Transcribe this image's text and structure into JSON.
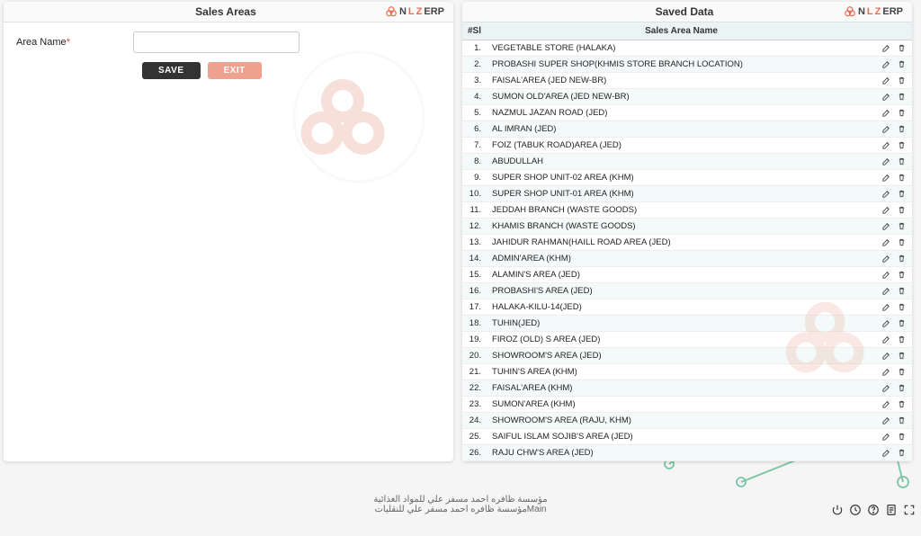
{
  "brand": {
    "n": "N",
    "l": "L",
    "z": "Z",
    "erp": "ERP"
  },
  "panels": {
    "left": {
      "title": "Sales Areas"
    },
    "right": {
      "title": "Saved Data"
    }
  },
  "form": {
    "area_label": "Area Name",
    "area_value": "",
    "save_label": "SAVE",
    "exit_label": "EXIT"
  },
  "table": {
    "head_num": "#Sl",
    "head_name": "Sales Area Name",
    "rows": [
      {
        "n": "1.",
        "name": "VEGETABLE STORE (HALAKA)"
      },
      {
        "n": "2.",
        "name": "PROBASHI SUPER SHOP(KHMIS STORE BRANCH LOCATION)"
      },
      {
        "n": "3.",
        "name": "FAISAL'AREA (JED NEW-BR)"
      },
      {
        "n": "4.",
        "name": "SUMON OLD'AREA (JED NEW-BR)"
      },
      {
        "n": "5.",
        "name": "NAZMUL JAZAN ROAD (JED)"
      },
      {
        "n": "6.",
        "name": "AL IMRAN (JED)"
      },
      {
        "n": "7.",
        "name": "FOIZ (TABUK ROAD)AREA (JED)"
      },
      {
        "n": "8.",
        "name": "ABUDULLAH"
      },
      {
        "n": "9.",
        "name": "SUPER SHOP UNIT-02 AREA (KHM)"
      },
      {
        "n": "10.",
        "name": "SUPER SHOP UNIT-01 AREA (KHM)"
      },
      {
        "n": "11.",
        "name": "JEDDAH BRANCH (WASTE GOODS)"
      },
      {
        "n": "12.",
        "name": "KHAMIS BRANCH (WASTE GOODS)"
      },
      {
        "n": "13.",
        "name": "JAHIDUR RAHMAN(HAILL ROAD AREA (JED)"
      },
      {
        "n": "14.",
        "name": "ADMIN'AREA (KHM)"
      },
      {
        "n": "15.",
        "name": "ALAMIN'S AREA (JED)"
      },
      {
        "n": "16.",
        "name": "PROBASHI'S AREA (JED)"
      },
      {
        "n": "17.",
        "name": "HALAKA-KILU-14(JED)"
      },
      {
        "n": "18.",
        "name": "TUHIN(JED)"
      },
      {
        "n": "19.",
        "name": "FIROZ (OLD) S AREA (JED)"
      },
      {
        "n": "20.",
        "name": "SHOWROOM'S AREA (JED)"
      },
      {
        "n": "21.",
        "name": "TUHIN'S AREA (KHM)"
      },
      {
        "n": "22.",
        "name": "FAISAL'AREA (KHM)"
      },
      {
        "n": "23.",
        "name": "SUMON'AREA (KHM)"
      },
      {
        "n": "24.",
        "name": "SHOWROOM'S AREA (RAJU, KHM)"
      },
      {
        "n": "25.",
        "name": "SAIFUL ISLAM SOJIB'S AREA (JED)"
      },
      {
        "n": "26.",
        "name": "RAJU CHW'S AREA (JED)"
      }
    ]
  },
  "footer": {
    "line1": "مؤسسة ظافره احمد مسفر علي للمواد الغذائية",
    "line2": "Mainمؤسسة ظافره احمد مسفر علي للنقليات"
  }
}
